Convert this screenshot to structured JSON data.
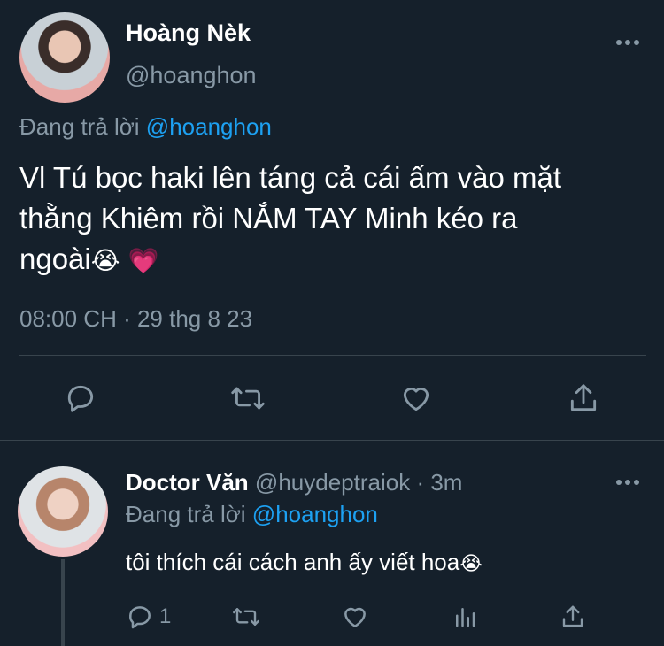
{
  "main_tweet": {
    "display_name": "Hoàng Nèk",
    "handle": "@hoanghon",
    "replying_to_label": "Đang trả lời",
    "replying_to_handle": "@hoanghon",
    "text_line1": "Vl Tú bọc haki lên táng cả cái ấm vào mặt",
    "text_line2": "thằng Khiêm rồi NẮM TAY Minh kéo ra",
    "text_line3": "ngoài",
    "emoji_cry": "😭",
    "emoji_heart": "💗",
    "timestamp": "08:00 CH · 29 thg 8 23",
    "more_icon": "more-horizontal",
    "actions": [
      "reply-icon",
      "retweet-icon",
      "like-icon",
      "share-icon"
    ]
  },
  "reply_tweet": {
    "display_name": "Doctor Văn",
    "handle": "@huydeptraiok",
    "separator": "·",
    "time": "3m",
    "replying_to_label": "Đang trả lời",
    "replying_to_handle": "@hoanghon",
    "text": "tôi thích cái cách anh ấy viết hoa",
    "emoji_cry": "😭",
    "reply_count": "1",
    "actions": [
      "reply-icon",
      "retweet-icon",
      "like-icon",
      "analytics-icon",
      "share-icon"
    ]
  },
  "colors": {
    "background": "#15202b",
    "text": "#ffffff",
    "muted": "#8899a6",
    "link": "#1da1f2",
    "divider": "#38444d"
  }
}
